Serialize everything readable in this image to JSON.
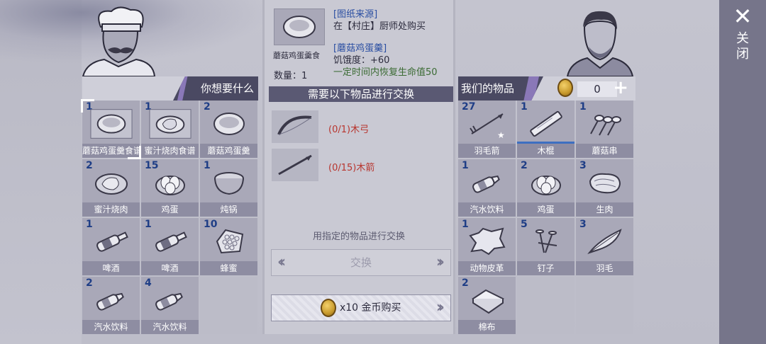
{
  "left_panel": {
    "title": "你想要什么",
    "items": [
      {
        "count": "1",
        "label": "蘑菇鸡蛋羹食谱",
        "icon": "recipe-bowl-icon",
        "selected": true
      },
      {
        "count": "1",
        "label": "蜜汁烧肉食谱",
        "icon": "recipe-meat-icon"
      },
      {
        "count": "2",
        "label": "蘑菇鸡蛋羹",
        "icon": "soup-bowl-icon"
      },
      {
        "count": "2",
        "label": "蜜汁烧肉",
        "icon": "roast-meat-icon"
      },
      {
        "count": "15",
        "label": "鸡蛋",
        "icon": "eggs-icon"
      },
      {
        "count": "1",
        "label": "炖锅",
        "icon": "pot-icon"
      },
      {
        "count": "1",
        "label": "啤酒",
        "icon": "beer-icon"
      },
      {
        "count": "1",
        "label": "啤酒",
        "icon": "beer-icon"
      },
      {
        "count": "10",
        "label": "蜂蜜",
        "icon": "honeycomb-icon"
      },
      {
        "count": "2",
        "label": "汽水饮料",
        "icon": "soda-icon"
      },
      {
        "count": "4",
        "label": "汽水饮料",
        "icon": "soda-icon"
      }
    ]
  },
  "detail": {
    "recipe_name": "蘑菇鸡蛋羹食",
    "quantity": "数量：1",
    "source_title": "[图纸来源]",
    "source_text": "在【村庄】厨师处购买",
    "item_title": "[蘑菇鸡蛋羹]",
    "hunger": "饥饿度：+60",
    "effect": "一定时间内恢复生命值50",
    "need_header": "需要以下物品进行交换",
    "requirements": [
      {
        "text": "(0/1)木弓",
        "icon": "bow-icon"
      },
      {
        "text": "(0/15)木箭",
        "icon": "arrow-icon"
      }
    ],
    "hint": "用指定的物品进行交换",
    "exchange_label": "交换",
    "buy_label": "x10 金币购买"
  },
  "right_panel": {
    "title": "我们的物品",
    "coins": "0",
    "items": [
      {
        "count": "27",
        "label": "羽毛箭",
        "icon": "feather-arrow-icon"
      },
      {
        "count": "1",
        "label": "木棍",
        "icon": "wood-stick-icon",
        "durability": 1.0
      },
      {
        "count": "1",
        "label": "蘑菇串",
        "icon": "mushroom-skewer-icon"
      },
      {
        "count": "1",
        "label": "汽水饮料",
        "icon": "soda-icon"
      },
      {
        "count": "2",
        "label": "鸡蛋",
        "icon": "eggs-icon"
      },
      {
        "count": "3",
        "label": "生肉",
        "icon": "raw-meat-icon"
      },
      {
        "count": "1",
        "label": "动物皮革",
        "icon": "leather-icon"
      },
      {
        "count": "5",
        "label": "钉子",
        "icon": "nails-icon"
      },
      {
        "count": "3",
        "label": "羽毛",
        "icon": "feather-icon"
      },
      {
        "count": "2",
        "label": "棉布",
        "icon": "cloth-icon"
      }
    ]
  },
  "close_label": "关闭",
  "colors": {
    "accent": "#4a4962",
    "count_blue": "#1f3e86",
    "req_red": "#b8352e",
    "effect_green": "#3b6b34"
  }
}
